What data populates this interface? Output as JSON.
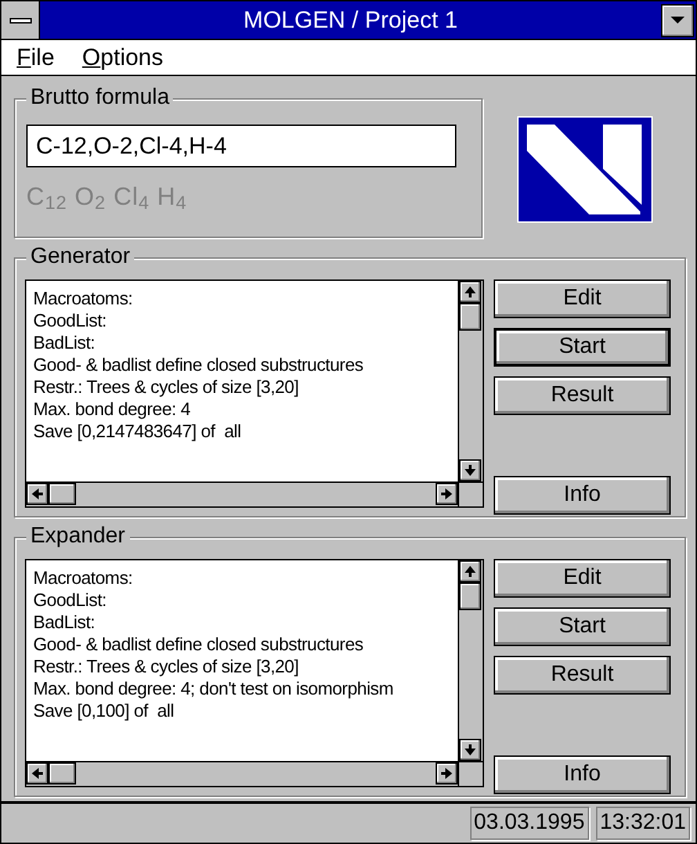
{
  "window": {
    "title": "MOLGEN / Project 1"
  },
  "menu": [
    {
      "label": "File"
    },
    {
      "label": "Options"
    }
  ],
  "brutto": {
    "title": "Brutto formula",
    "value": "C-12,O-2,Cl-4,H-4",
    "formula": "C$_{12}$ O$_{2}$ Cl$_{4}$ H$_{4}$"
  },
  "panels": [
    {
      "title": "Generator",
      "lines": [
        "Macroatoms:",
        "GoodList:",
        "BadList:",
        "Good- & badlist define closed substructures",
        "Restr.: Trees & cycles of size [3,20]",
        "Max. bond degree: 4",
        "Save [0,2147483647] of  all"
      ],
      "buttons": [
        {
          "label": "Edit",
          "default": false
        },
        {
          "label": "Start",
          "default": true
        },
        {
          "label": "Result",
          "default": false
        }
      ],
      "info": "Info"
    },
    {
      "title": "Expander",
      "lines": [
        "Macroatoms:",
        "GoodList:",
        "BadList:",
        "Good- & badlist define closed substructures",
        "Restr.: Trees & cycles of size [3,20]",
        "Max. bond degree: 4; don't test on isomorphism",
        "Save [0,100] of  all"
      ],
      "buttons": [
        {
          "label": "Edit",
          "default": false
        },
        {
          "label": "Start",
          "default": false
        },
        {
          "label": "Result",
          "default": false
        }
      ],
      "info": "Info"
    }
  ],
  "status_bar": {
    "date": "03.03.1995",
    "time": "13:32:01"
  }
}
